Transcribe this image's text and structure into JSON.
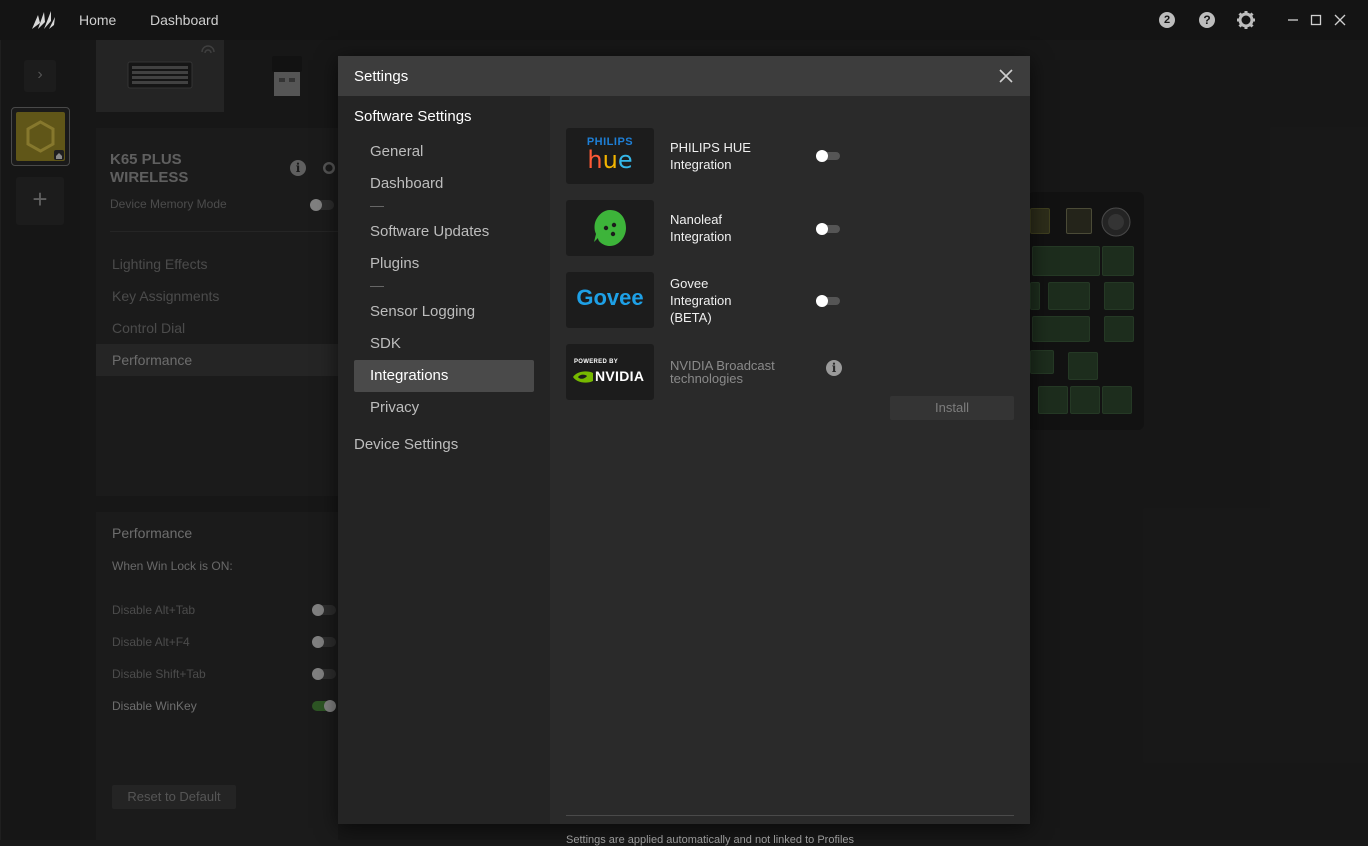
{
  "topbar": {
    "nav": [
      "Home",
      "Dashboard"
    ],
    "badge_count": "2",
    "icons": [
      "badge-icon",
      "help-icon",
      "gear-icon",
      "minimize-icon",
      "maximize-icon",
      "close-icon"
    ]
  },
  "rail": {
    "expand_glyph": "›",
    "add_glyph": "+"
  },
  "background": {
    "device_name_line1": "K65 PLUS",
    "device_name_line2": "WIRELESS",
    "memory_mode": "Device Memory Mode",
    "menu": [
      "Lighting Effects",
      "Key Assignments",
      "Control Dial",
      "Performance"
    ],
    "perf_title": "Performance",
    "perf_sub": "When Win Lock is ON:",
    "options": [
      {
        "label": "Disable Alt+Tab",
        "on": false
      },
      {
        "label": "Disable Alt+F4",
        "on": false
      },
      {
        "label": "Disable Shift+Tab",
        "on": false
      },
      {
        "label": "Disable WinKey",
        "on": true
      }
    ],
    "reset": "Reset to Default"
  },
  "modal": {
    "title": "Settings",
    "nav": {
      "section1": "Software Settings",
      "items": [
        "General",
        "Dashboard",
        "Software Updates",
        "Plugins",
        "Sensor Logging",
        "SDK",
        "Integrations",
        "Privacy"
      ],
      "active": "Integrations",
      "section2": "Device Settings"
    },
    "integrations": [
      {
        "name_line1": "PHILIPS HUE",
        "name_line2": "Integration",
        "logo_top": "PHILIPS",
        "logo_main": "hue",
        "enabled": false
      },
      {
        "name_line1": "Nanoleaf",
        "name_line2": "Integration",
        "enabled": false
      },
      {
        "name_line1": "Govee",
        "name_line2": "Integration",
        "name_line3": "(BETA)",
        "logo_main": "Govee",
        "enabled": false
      },
      {
        "name_line1": "NVIDIA Broadcast",
        "name_line2": "technologies",
        "logo_top": "POWERED BY",
        "logo_main": "NVIDIA",
        "button": "Install"
      }
    ],
    "footer": "Settings are applied automatically and not linked to Profiles"
  },
  "colors": {
    "accent_gold": "#9c8b27",
    "nanoleaf_green": "#3db43a",
    "govee_blue": "#1ea0e6",
    "nvidia_green": "#76b900"
  }
}
